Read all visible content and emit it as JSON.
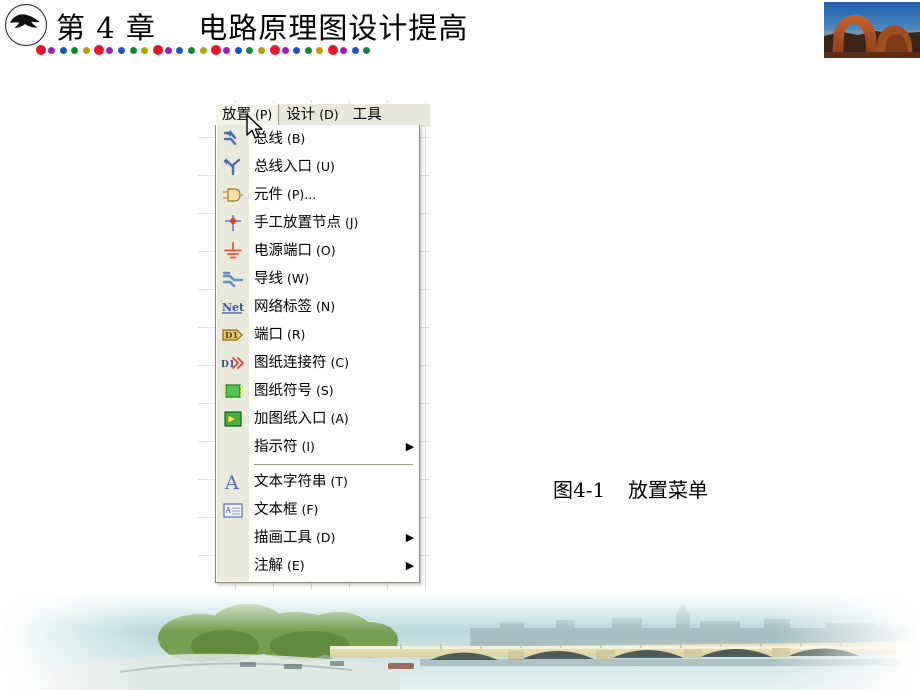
{
  "slide": {
    "title_prefix": "第 4 章",
    "title_text": "电路原理图设计提高",
    "logo_name": "bird-circle-logo",
    "photo_alt": "delicate-arch-photo",
    "footer_alt": "bridge-river-panorama",
    "dot_colors": [
      "#e8152a",
      "#9e1fbe",
      "#1555c8",
      "#0f8a3c",
      "#b4a400"
    ]
  },
  "app": {
    "menubar": {
      "items": [
        {
          "label": "放置",
          "accel": "(P)",
          "selected": true
        },
        {
          "label": "设计",
          "accel": "(D)",
          "selected": false
        },
        {
          "label": "工具",
          "accel": "",
          "selected": false
        }
      ]
    },
    "menu": {
      "name": "place-menu",
      "items": [
        {
          "label": "总线",
          "accel": "(B)",
          "icon": "bus-icon",
          "submenu": false,
          "sep_after": false
        },
        {
          "label": "总线入口",
          "accel": "(U)",
          "icon": "bus-entry-icon",
          "submenu": false,
          "sep_after": false
        },
        {
          "label": "元件",
          "accel": "(P)...",
          "icon": "part-icon",
          "submenu": false,
          "sep_after": false
        },
        {
          "label": "手工放置节点",
          "accel": "(J)",
          "icon": "junction-icon",
          "submenu": false,
          "sep_after": false
        },
        {
          "label": "电源端口",
          "accel": "(O)",
          "icon": "power-port-icon",
          "submenu": false,
          "sep_after": false
        },
        {
          "label": "导线",
          "accel": "(W)",
          "icon": "wire-icon",
          "submenu": false,
          "sep_after": false
        },
        {
          "label": "网络标签",
          "accel": "(N)",
          "icon": "net-label-icon",
          "submenu": false,
          "sep_after": false
        },
        {
          "label": "端口",
          "accel": "(R)",
          "icon": "port-icon",
          "submenu": false,
          "sep_after": false
        },
        {
          "label": "图纸连接符",
          "accel": "(C)",
          "icon": "sheet-connector-icon",
          "submenu": false,
          "sep_after": false
        },
        {
          "label": "图纸符号",
          "accel": "(S)",
          "icon": "sheet-symbol-icon",
          "submenu": false,
          "sep_after": false
        },
        {
          "label": "加图纸入口",
          "accel": "(A)",
          "icon": "sheet-entry-icon",
          "submenu": false,
          "sep_after": false
        },
        {
          "label": "指示符",
          "accel": "(I)",
          "icon": "none",
          "submenu": true,
          "sep_after": true
        },
        {
          "label": "文本字符串",
          "accel": "(T)",
          "icon": "text-string-icon",
          "submenu": false,
          "sep_after": false
        },
        {
          "label": "文本框",
          "accel": "(F)",
          "icon": "text-frame-icon",
          "submenu": false,
          "sep_after": false
        },
        {
          "label": "描画工具",
          "accel": "(D)",
          "icon": "none",
          "submenu": true,
          "sep_after": false
        },
        {
          "label": "注解",
          "accel": "(E)",
          "icon": "none",
          "submenu": true,
          "sep_after": false
        }
      ]
    },
    "cursor": "mouse-pointer-icon"
  },
  "caption": {
    "number": "图4-1",
    "text": "放置菜单"
  }
}
